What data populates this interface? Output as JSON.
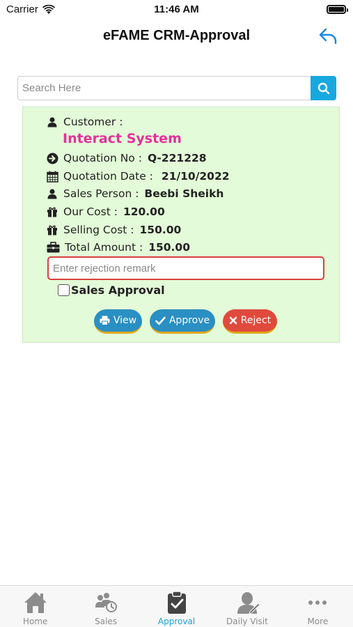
{
  "status_bar": {
    "carrier": "Carrier",
    "time": "11:46 AM"
  },
  "header": {
    "title": "eFAME CRM-Approval"
  },
  "search": {
    "placeholder": "Search Here",
    "value": ""
  },
  "quotation_card": {
    "customer_label": "Customer :",
    "customer_name": "Interact System",
    "quotation_no_label": "Quotation No :",
    "quotation_no": "Q-221228",
    "quotation_date_label": "Quotation Date :",
    "quotation_date": "21/10/2022",
    "sales_person_label": "Sales Person :",
    "sales_person": "Beebi Sheikh",
    "our_cost_label": "Our Cost :",
    "our_cost": "120.00",
    "selling_cost_label": "Selling Cost :",
    "selling_cost": "150.00",
    "total_amount_label": "Total Amount :",
    "total_amount": "150.00",
    "remark_placeholder": "Enter rejection remark",
    "sales_approval_label": "Sales Approval",
    "sales_approval_checked": false,
    "buttons": {
      "view": "View",
      "approve": "Approve",
      "reject": "Reject"
    }
  },
  "tab_bar": {
    "tabs": [
      {
        "label": "Home",
        "icon": "home-icon",
        "active": false
      },
      {
        "label": "Sales",
        "icon": "sales-icon",
        "active": false
      },
      {
        "label": "Approval",
        "icon": "approval-icon",
        "active": true
      },
      {
        "label": "Daily Visit",
        "icon": "daily-visit-icon",
        "active": false
      },
      {
        "label": "More",
        "icon": "more-icon",
        "active": false
      }
    ]
  },
  "colors": {
    "accent": "#1aa3db",
    "card_background": "#e3fbd8",
    "customer_name": "#e5309b",
    "button_blue": "#2a8fc2",
    "button_red": "#e04a3c",
    "remark_border": "#d9413b"
  }
}
